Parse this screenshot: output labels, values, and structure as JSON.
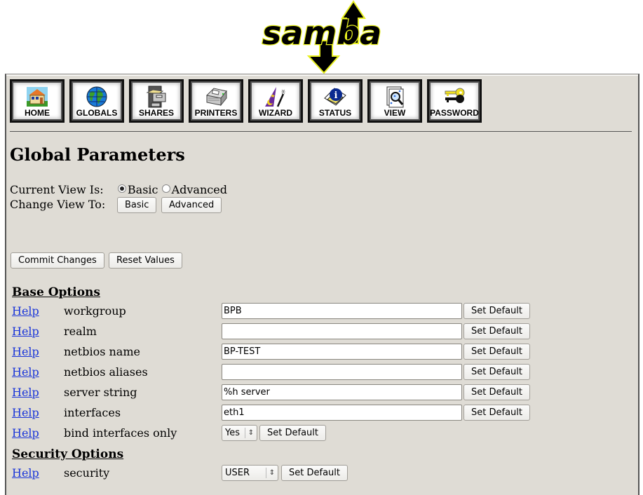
{
  "logo": {
    "text": "samba"
  },
  "nav": [
    {
      "label": "HOME",
      "icon": "home-icon"
    },
    {
      "label": "GLOBALS",
      "icon": "globe-icon"
    },
    {
      "label": "SHARES",
      "icon": "file-cabinet-icon"
    },
    {
      "label": "PRINTERS",
      "icon": "printer-icon"
    },
    {
      "label": "WIZARD",
      "icon": "wizard-hat-icon"
    },
    {
      "label": "STATUS",
      "icon": "info-icon"
    },
    {
      "label": "VIEW",
      "icon": "magnifier-document-icon"
    },
    {
      "label": "PASSWORD",
      "icon": "keys-icon"
    }
  ],
  "page_title": "Global Parameters",
  "view": {
    "current_label": "Current View Is:",
    "current_options": [
      "Basic",
      "Advanced"
    ],
    "current_selected": "Basic",
    "change_label": "Change View To:",
    "change_buttons": [
      "Basic",
      "Advanced"
    ]
  },
  "actions": {
    "commit": "Commit Changes",
    "reset": "Reset Values"
  },
  "help_label": "Help",
  "set_default_label": "Set Default",
  "sections": [
    {
      "title": "Base Options",
      "params": [
        {
          "name": "workgroup",
          "type": "text",
          "value": "BPB"
        },
        {
          "name": "realm",
          "type": "text",
          "value": ""
        },
        {
          "name": "netbios name",
          "type": "text",
          "value": "BP-TEST"
        },
        {
          "name": "netbios aliases",
          "type": "text",
          "value": ""
        },
        {
          "name": "server string",
          "type": "text",
          "value": "%h server"
        },
        {
          "name": "interfaces",
          "type": "text",
          "value": "eth1"
        },
        {
          "name": "bind interfaces only",
          "type": "select",
          "value": "Yes"
        }
      ]
    },
    {
      "title": "Security Options",
      "params": [
        {
          "name": "security",
          "type": "select",
          "value": "USER"
        }
      ]
    }
  ],
  "colors": {
    "panel_bg": "#dfdcd5",
    "link": "#1a35d8"
  }
}
